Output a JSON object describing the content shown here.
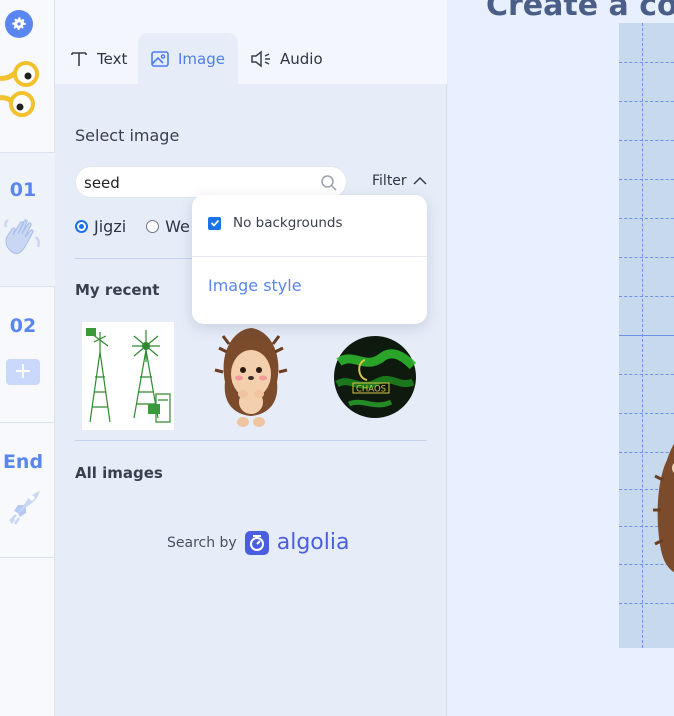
{
  "tabs": [
    {
      "label": "Text",
      "icon": "text-icon"
    },
    {
      "label": "Image",
      "icon": "image-icon",
      "active": true
    },
    {
      "label": "Audio",
      "icon": "audio-icon"
    }
  ],
  "rail": {
    "slides": [
      {
        "number": "01",
        "icon": "hand-wave-icon"
      },
      {
        "number": "02",
        "add_label": "+"
      },
      {
        "number": "End",
        "icon": "rocket-icon"
      }
    ]
  },
  "panel": {
    "select_label": "Select image",
    "search": {
      "value": "seed"
    },
    "filter_label": "Filter",
    "sources": [
      {
        "label": "Jigzi",
        "selected": true
      },
      {
        "label": "We",
        "selected": false
      }
    ],
    "my_recent_heading": "My recent",
    "recent_images": [
      "windmill-image",
      "hedgehog-image",
      "bowling-ball-image"
    ],
    "bowling_ball_text": "CHAOS",
    "all_images_heading": "All images",
    "search_by_label": "Search by",
    "algolia_label": "algolia"
  },
  "dropdown": {
    "no_backgrounds_label": "No backgrounds",
    "no_backgrounds_checked": true,
    "image_style_label": "Image style"
  },
  "canvas": {
    "title": "Create a co"
  },
  "colors": {
    "accent": "#5a86f2",
    "checkbox": "#1a73e8",
    "panel_bg": "#e6edf8"
  }
}
